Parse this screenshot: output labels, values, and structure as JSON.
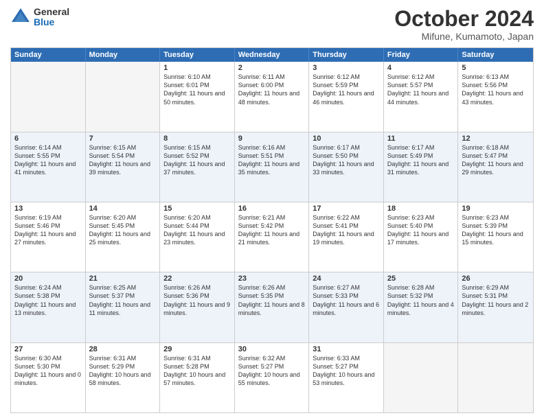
{
  "logo": {
    "general": "General",
    "blue": "Blue"
  },
  "header": {
    "month": "October 2024",
    "location": "Mifune, Kumamoto, Japan"
  },
  "weekdays": [
    "Sunday",
    "Monday",
    "Tuesday",
    "Wednesday",
    "Thursday",
    "Friday",
    "Saturday"
  ],
  "rows": [
    [
      {
        "day": "",
        "sunrise": "",
        "sunset": "",
        "daylight": "",
        "empty": true
      },
      {
        "day": "",
        "sunrise": "",
        "sunset": "",
        "daylight": "",
        "empty": true
      },
      {
        "day": "1",
        "sunrise": "Sunrise: 6:10 AM",
        "sunset": "Sunset: 6:01 PM",
        "daylight": "Daylight: 11 hours and 50 minutes."
      },
      {
        "day": "2",
        "sunrise": "Sunrise: 6:11 AM",
        "sunset": "Sunset: 6:00 PM",
        "daylight": "Daylight: 11 hours and 48 minutes."
      },
      {
        "day": "3",
        "sunrise": "Sunrise: 6:12 AM",
        "sunset": "Sunset: 5:59 PM",
        "daylight": "Daylight: 11 hours and 46 minutes."
      },
      {
        "day": "4",
        "sunrise": "Sunrise: 6:12 AM",
        "sunset": "Sunset: 5:57 PM",
        "daylight": "Daylight: 11 hours and 44 minutes."
      },
      {
        "day": "5",
        "sunrise": "Sunrise: 6:13 AM",
        "sunset": "Sunset: 5:56 PM",
        "daylight": "Daylight: 11 hours and 43 minutes."
      }
    ],
    [
      {
        "day": "6",
        "sunrise": "Sunrise: 6:14 AM",
        "sunset": "Sunset: 5:55 PM",
        "daylight": "Daylight: 11 hours and 41 minutes."
      },
      {
        "day": "7",
        "sunrise": "Sunrise: 6:15 AM",
        "sunset": "Sunset: 5:54 PM",
        "daylight": "Daylight: 11 hours and 39 minutes."
      },
      {
        "day": "8",
        "sunrise": "Sunrise: 6:15 AM",
        "sunset": "Sunset: 5:52 PM",
        "daylight": "Daylight: 11 hours and 37 minutes."
      },
      {
        "day": "9",
        "sunrise": "Sunrise: 6:16 AM",
        "sunset": "Sunset: 5:51 PM",
        "daylight": "Daylight: 11 hours and 35 minutes."
      },
      {
        "day": "10",
        "sunrise": "Sunrise: 6:17 AM",
        "sunset": "Sunset: 5:50 PM",
        "daylight": "Daylight: 11 hours and 33 minutes."
      },
      {
        "day": "11",
        "sunrise": "Sunrise: 6:17 AM",
        "sunset": "Sunset: 5:49 PM",
        "daylight": "Daylight: 11 hours and 31 minutes."
      },
      {
        "day": "12",
        "sunrise": "Sunrise: 6:18 AM",
        "sunset": "Sunset: 5:47 PM",
        "daylight": "Daylight: 11 hours and 29 minutes."
      }
    ],
    [
      {
        "day": "13",
        "sunrise": "Sunrise: 6:19 AM",
        "sunset": "Sunset: 5:46 PM",
        "daylight": "Daylight: 11 hours and 27 minutes."
      },
      {
        "day": "14",
        "sunrise": "Sunrise: 6:20 AM",
        "sunset": "Sunset: 5:45 PM",
        "daylight": "Daylight: 11 hours and 25 minutes."
      },
      {
        "day": "15",
        "sunrise": "Sunrise: 6:20 AM",
        "sunset": "Sunset: 5:44 PM",
        "daylight": "Daylight: 11 hours and 23 minutes."
      },
      {
        "day": "16",
        "sunrise": "Sunrise: 6:21 AM",
        "sunset": "Sunset: 5:42 PM",
        "daylight": "Daylight: 11 hours and 21 minutes."
      },
      {
        "day": "17",
        "sunrise": "Sunrise: 6:22 AM",
        "sunset": "Sunset: 5:41 PM",
        "daylight": "Daylight: 11 hours and 19 minutes."
      },
      {
        "day": "18",
        "sunrise": "Sunrise: 6:23 AM",
        "sunset": "Sunset: 5:40 PM",
        "daylight": "Daylight: 11 hours and 17 minutes."
      },
      {
        "day": "19",
        "sunrise": "Sunrise: 6:23 AM",
        "sunset": "Sunset: 5:39 PM",
        "daylight": "Daylight: 11 hours and 15 minutes."
      }
    ],
    [
      {
        "day": "20",
        "sunrise": "Sunrise: 6:24 AM",
        "sunset": "Sunset: 5:38 PM",
        "daylight": "Daylight: 11 hours and 13 minutes."
      },
      {
        "day": "21",
        "sunrise": "Sunrise: 6:25 AM",
        "sunset": "Sunset: 5:37 PM",
        "daylight": "Daylight: 11 hours and 11 minutes."
      },
      {
        "day": "22",
        "sunrise": "Sunrise: 6:26 AM",
        "sunset": "Sunset: 5:36 PM",
        "daylight": "Daylight: 11 hours and 9 minutes."
      },
      {
        "day": "23",
        "sunrise": "Sunrise: 6:26 AM",
        "sunset": "Sunset: 5:35 PM",
        "daylight": "Daylight: 11 hours and 8 minutes."
      },
      {
        "day": "24",
        "sunrise": "Sunrise: 6:27 AM",
        "sunset": "Sunset: 5:33 PM",
        "daylight": "Daylight: 11 hours and 6 minutes."
      },
      {
        "day": "25",
        "sunrise": "Sunrise: 6:28 AM",
        "sunset": "Sunset: 5:32 PM",
        "daylight": "Daylight: 11 hours and 4 minutes."
      },
      {
        "day": "26",
        "sunrise": "Sunrise: 6:29 AM",
        "sunset": "Sunset: 5:31 PM",
        "daylight": "Daylight: 11 hours and 2 minutes."
      }
    ],
    [
      {
        "day": "27",
        "sunrise": "Sunrise: 6:30 AM",
        "sunset": "Sunset: 5:30 PM",
        "daylight": "Daylight: 11 hours and 0 minutes."
      },
      {
        "day": "28",
        "sunrise": "Sunrise: 6:31 AM",
        "sunset": "Sunset: 5:29 PM",
        "daylight": "Daylight: 10 hours and 58 minutes."
      },
      {
        "day": "29",
        "sunrise": "Sunrise: 6:31 AM",
        "sunset": "Sunset: 5:28 PM",
        "daylight": "Daylight: 10 hours and 57 minutes."
      },
      {
        "day": "30",
        "sunrise": "Sunrise: 6:32 AM",
        "sunset": "Sunset: 5:27 PM",
        "daylight": "Daylight: 10 hours and 55 minutes."
      },
      {
        "day": "31",
        "sunrise": "Sunrise: 6:33 AM",
        "sunset": "Sunset: 5:27 PM",
        "daylight": "Daylight: 10 hours and 53 minutes."
      },
      {
        "day": "",
        "sunrise": "",
        "sunset": "",
        "daylight": "",
        "empty": true
      },
      {
        "day": "",
        "sunrise": "",
        "sunset": "",
        "daylight": "",
        "empty": true
      }
    ]
  ]
}
